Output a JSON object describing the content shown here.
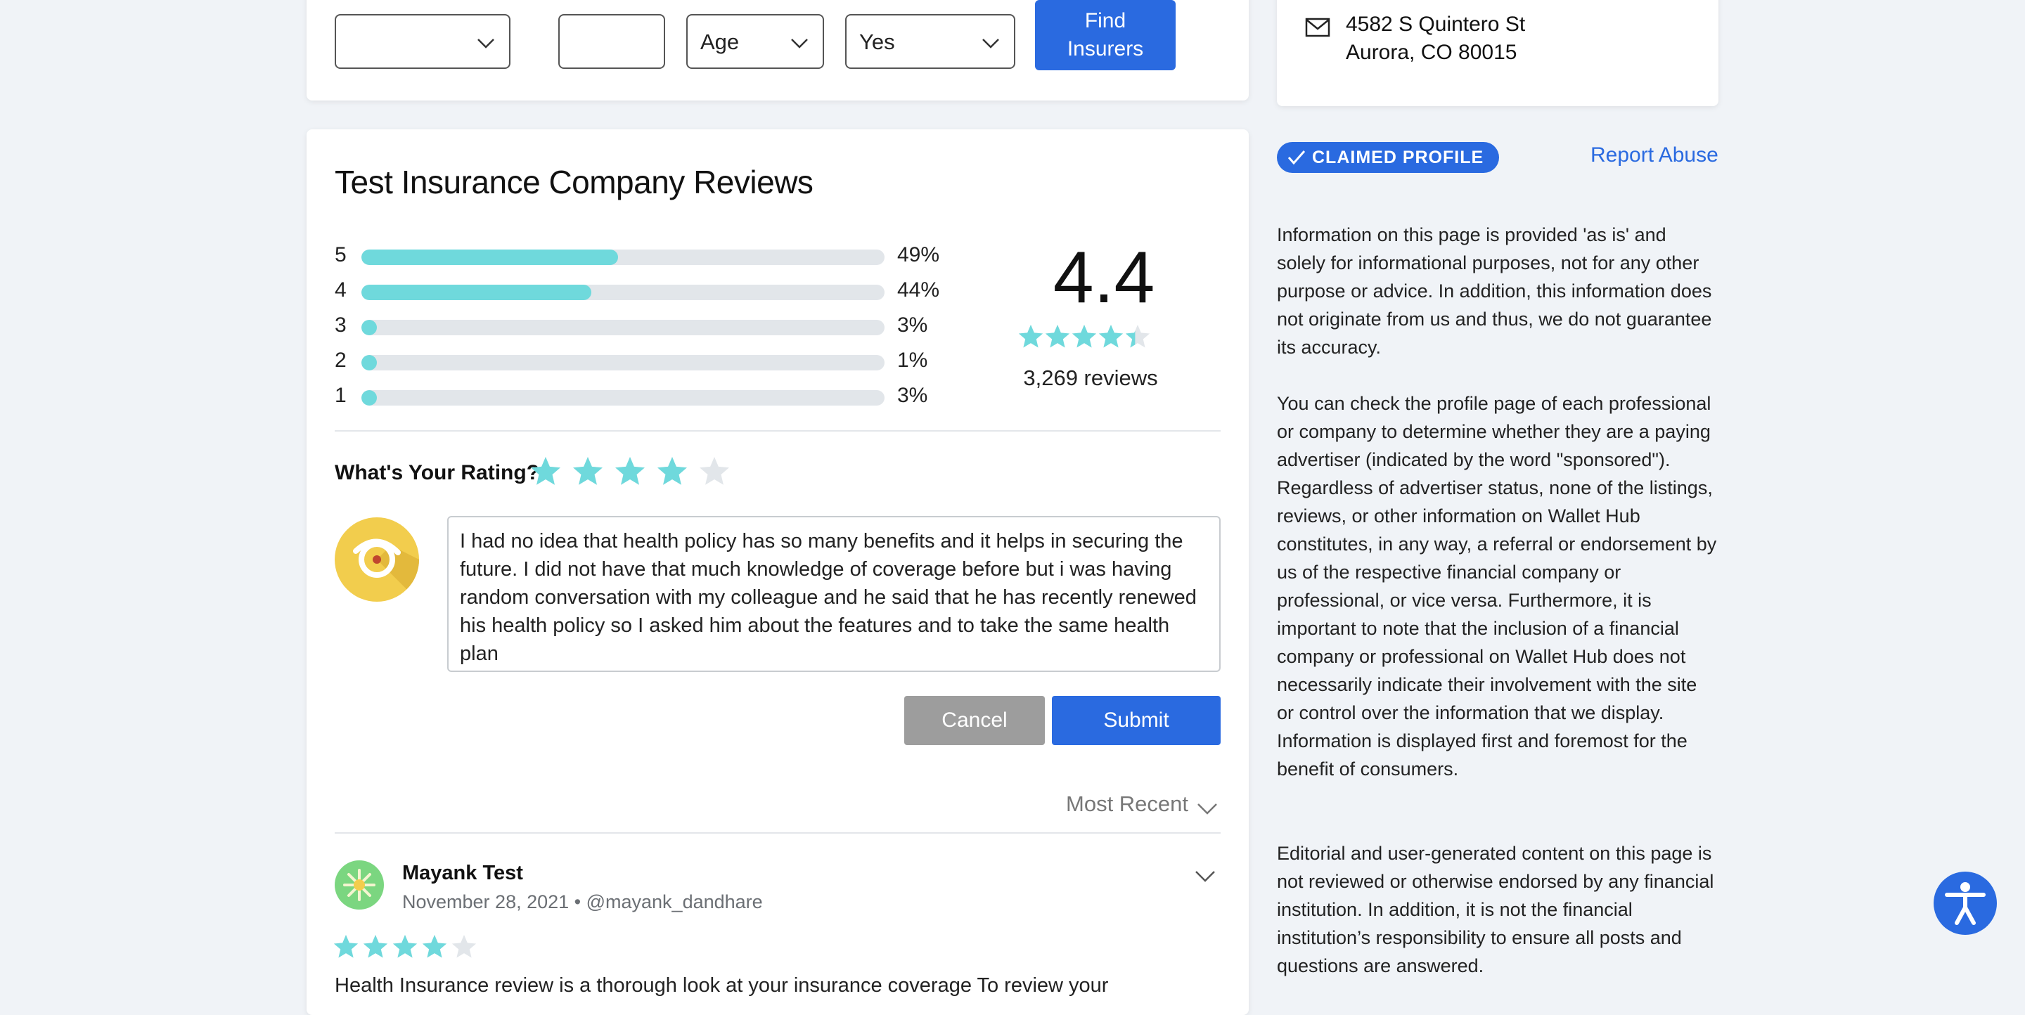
{
  "search": {
    "type_value": "",
    "zip_value": "",
    "age_value": "Age",
    "insured_value": "Yes",
    "find_label": "Find Insurers"
  },
  "reviews": {
    "title": "Test Insurance Company Reviews",
    "distribution": [
      {
        "stars": "5",
        "pct": "49%",
        "fraction": 0.49
      },
      {
        "stars": "4",
        "pct": "44%",
        "fraction": 0.44
      },
      {
        "stars": "3",
        "pct": "3%",
        "fraction": 0.03
      },
      {
        "stars": "2",
        "pct": "1%",
        "fraction": 0.01
      },
      {
        "stars": "1",
        "pct": "3%",
        "fraction": 0.03
      }
    ],
    "average": "4.4",
    "average_value": 4.4,
    "count_label": "3,269 reviews"
  },
  "compose": {
    "rating_label": "What's Your Rating?",
    "selected_rating": 4,
    "text": "I had no idea that health policy has so many benefits and it helps in securing the future. I did not have that much knowledge of coverage before but i was having random conversation with my colleague and he said that he has recently renewed his health policy so I asked him about the features and to take the same health plan",
    "cancel_label": "Cancel",
    "submit_label": "Submit"
  },
  "sort": {
    "label": "Most Recent"
  },
  "review_item": {
    "name": "Mayank Test",
    "meta": "November 28, 2021 • @mayank_dandhare",
    "rating": 4,
    "snippet": "Health Insurance review is a thorough look at your insurance coverage To review your"
  },
  "contact": {
    "address_line1": "4582 S Quintero St",
    "address_line2": "Aurora, CO 80015"
  },
  "profile": {
    "claimed_label": "CLAIMED PROFILE",
    "report_label": "Report Abuse"
  },
  "disclaimer": {
    "p1": "Information on this page is provided 'as is' and solely for informational purposes, not for any other purpose or advice. In addition, this information does not originate from us and thus, we do not guarantee its accuracy.",
    "p2": "You can check the profile page of each professional or company to determine whether they are a paying advertiser (indicated by the word \"sponsored\"). Regardless of advertiser status, none of the listings, reviews, or other information on Wallet Hub constitutes, in any way, a referral or endorsement by us of the respective financial company or professional, or vice versa. Furthermore, it is important to note that the inclusion of a financial company or professional on Wallet Hub does not necessarily indicate their involvement with the site or control over the information that we display. Information is displayed first and foremost for the benefit of consumers.",
    "p3": "Editorial and user-generated content on this page is not reviewed or otherwise endorsed by any financial institution. In addition, it is not the financial institution’s responsibility to ensure all posts and questions are answered."
  },
  "colors": {
    "accent": "#2a6ae0",
    "star": "#6fd9dc",
    "star_empty": "#e2e6ea"
  }
}
